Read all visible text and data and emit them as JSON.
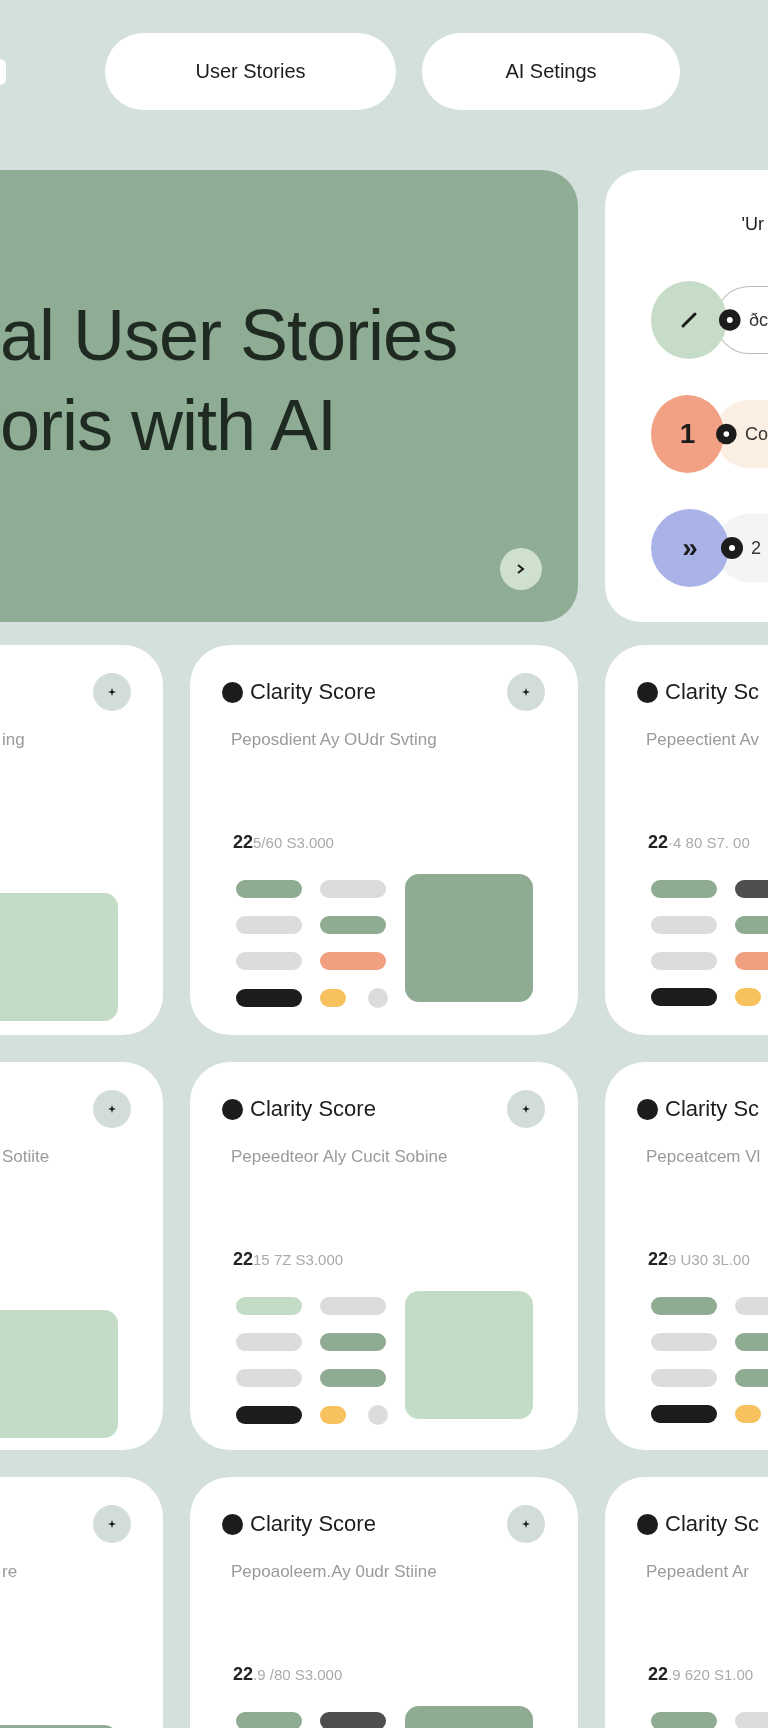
{
  "nav": {
    "buttons": [
      {
        "label": "User Stories"
      },
      {
        "label": "AI Setings"
      }
    ]
  },
  "hero": {
    "lines": [
      "al User Stories",
      "oris with AI"
    ]
  },
  "panel": {
    "heading": "'Ur",
    "items": [
      {
        "kind": "icon",
        "color": "#c6dcc8",
        "text": "ðc"
      },
      {
        "kind": "badge",
        "badge": "1",
        "color": "#f2a184",
        "text": "Co"
      },
      {
        "kind": "badge",
        "badge": "»",
        "color": "#aab3e8",
        "text": "2"
      }
    ]
  },
  "cards": [
    {
      "kind": "left",
      "subtitle": "ing",
      "block": {
        "color": "#c4dcc6"
      }
    },
    {
      "kind": "full",
      "title": "Clarity Score",
      "subtitle": "Peposdient Ay OUdr Svting",
      "value_main": "22",
      "value_rest": "5/60 S3.000",
      "block": {
        "color": "#8fab92"
      },
      "pills": [
        [
          {
            "kind": "bar",
            "color": "#8fab92"
          },
          {
            "kind": "bar",
            "color": "#dcdcdc"
          }
        ],
        [
          {
            "kind": "bar",
            "color": "#dcdcdc"
          },
          {
            "kind": "bar",
            "color": "#8fab92"
          }
        ],
        [
          {
            "kind": "bar",
            "color": "#dcdcdc"
          },
          {
            "kind": "bar",
            "color": "#f0a07e"
          }
        ],
        [
          {
            "kind": "bar",
            "color": "#1c1c1c"
          },
          {
            "kind": "dot",
            "color": "#f7c15e"
          },
          {
            "kind": "dot",
            "color": "#dcdcdc"
          }
        ]
      ]
    },
    {
      "kind": "right",
      "title": "Clarity Sc",
      "subtitle": "Pepeectient Av",
      "value_main": "22",
      "value_rest": "·4 80 S7. 00",
      "pills": [
        [
          {
            "kind": "bar",
            "color": "#8fab92"
          },
          {
            "kind": "bar",
            "color": "#4e4e4e"
          }
        ],
        [
          {
            "kind": "bar",
            "color": "#dcdcdc"
          },
          {
            "kind": "bar",
            "color": "#8fab92"
          }
        ],
        [
          {
            "kind": "bar",
            "color": "#dcdcdc"
          },
          {
            "kind": "bar",
            "color": "#f0a07e"
          }
        ],
        [
          {
            "kind": "bar",
            "color": "#1c1c1c"
          },
          {
            "kind": "dot",
            "color": "#f7c15e"
          }
        ]
      ]
    },
    {
      "kind": "left",
      "subtitle": "Sotiite",
      "block": {
        "color": "#c4dcc6"
      }
    },
    {
      "kind": "full",
      "title": "Clarity Score",
      "subtitle": "Pepeedteor Aly Cucit Sobine",
      "value_main": "22",
      "value_rest": "15 7Z S3.000",
      "block": {
        "color": "#c4dcc6"
      },
      "pills": [
        [
          {
            "kind": "bar",
            "color": "#c4dcc6"
          },
          {
            "kind": "bar",
            "color": "#dcdcdc"
          }
        ],
        [
          {
            "kind": "bar",
            "color": "#dcdcdc"
          },
          {
            "kind": "bar",
            "color": "#8fab92"
          }
        ],
        [
          {
            "kind": "bar",
            "color": "#dcdcdc"
          },
          {
            "kind": "bar",
            "color": "#8fab92"
          }
        ],
        [
          {
            "kind": "bar",
            "color": "#1c1c1c"
          },
          {
            "kind": "dot",
            "color": "#f7c15e"
          },
          {
            "kind": "dot",
            "color": "#dcdcdc"
          }
        ]
      ]
    },
    {
      "kind": "right",
      "title": "Clarity Sc",
      "subtitle": "Pepceatcem Vl",
      "value_main": "22",
      "value_rest": "9 U30 3L.00",
      "pills": [
        [
          {
            "kind": "bar",
            "color": "#8fab92"
          },
          {
            "kind": "bar",
            "color": "#dcdcdc"
          }
        ],
        [
          {
            "kind": "bar",
            "color": "#dcdcdc"
          },
          {
            "kind": "bar",
            "color": "#8fab92"
          }
        ],
        [
          {
            "kind": "bar",
            "color": "#dcdcdc"
          },
          {
            "kind": "bar",
            "color": "#8fab92"
          }
        ],
        [
          {
            "kind": "bar",
            "color": "#1c1c1c"
          },
          {
            "kind": "dot",
            "color": "#f7c15e"
          }
        ]
      ]
    },
    {
      "kind": "left",
      "subtitle": "re",
      "block": {
        "color": "#8fab92"
      }
    },
    {
      "kind": "full",
      "title": "Clarity Score",
      "subtitle": "Pepoaoleem.Ay 0udr Stiine",
      "value_main": "22",
      "value_rest": ".9 /80 S3.000",
      "block": {
        "color": "#8fab92"
      },
      "pills": [
        [
          {
            "kind": "bar",
            "color": "#8fab92"
          },
          {
            "kind": "bar",
            "color": "#4e4e4e"
          }
        ]
      ]
    },
    {
      "kind": "right",
      "title": "Clarity Sc",
      "subtitle": "Pepeadent Ar",
      "value_main": "22",
      "value_rest": ".9 620 S1.00",
      "pills": [
        [
          {
            "kind": "bar",
            "color": "#8fab92"
          },
          {
            "kind": "bar",
            "color": "#dcdcdc"
          }
        ]
      ]
    }
  ]
}
